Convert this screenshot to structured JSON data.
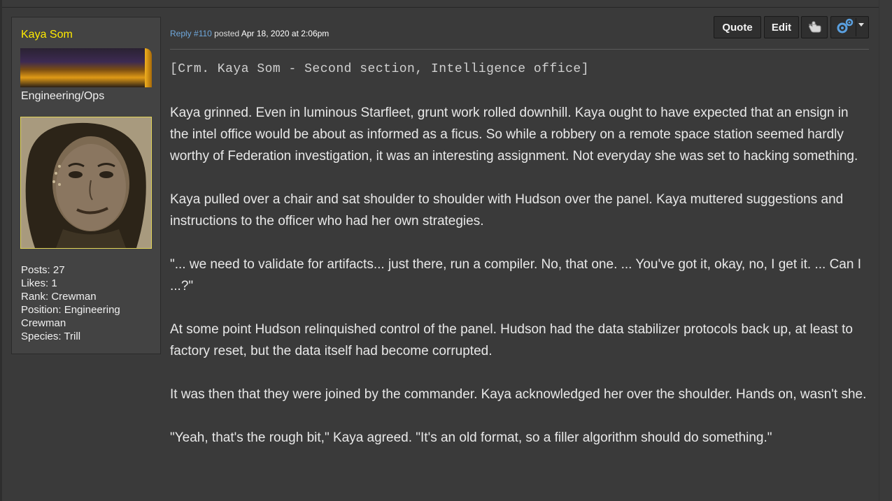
{
  "author": {
    "name": "Kaya Som",
    "role": "Engineering/Ops",
    "stats": {
      "posts": "Posts: 27",
      "likes": "Likes: 1",
      "rank": "Rank: Crewman",
      "position": "Position: Engineering Crewman",
      "species": "Species: Trill"
    }
  },
  "post": {
    "reply_label": "Reply #110",
    "posted_label": "posted",
    "date": "Apr 18, 2020 at 2:06pm",
    "heading": "[Crm. Kaya Som - Second section, Intelligence office]",
    "paragraphs": [
      "Kaya grinned. Even in luminous Starfleet, grunt work rolled downhill. Kaya ought to have expected that an ensign in the intel office would be about as informed as a ficus. So while a robbery on a remote space station seemed hardly worthy of Federation investigation, it was an interesting assignment. Not everyday she was set to hacking something.",
      "Kaya pulled over a chair and sat shoulder to shoulder with Hudson over the panel. Kaya muttered suggestions and instructions to the officer who had her own strategies.",
      "\"... we need to validate for artifacts... just there, run a compiler. No, that one. ... You've got it, okay, no, I get it. ... Can I ...?\"",
      "At some point Hudson relinquished control of the panel. Hudson had the data stabilizer protocols back up, at least to factory reset, but the data itself had become corrupted.",
      "It was then that they were joined by the commander. Kaya acknowledged her over the shoulder. Hands on, wasn't she.",
      "\"Yeah, that's the rough bit,\" Kaya agreed. \"It's an old format, so a filler algorithm should do something.\""
    ]
  },
  "toolbar": {
    "quote_label": "Quote",
    "edit_label": "Edit",
    "like_icon": "hand-pointer-icon",
    "options_icon": "gears-icon"
  },
  "colors": {
    "username": "#ffea00",
    "link": "#6fa8dc",
    "background": "#3a3a3a",
    "sidebar": "#434343"
  }
}
